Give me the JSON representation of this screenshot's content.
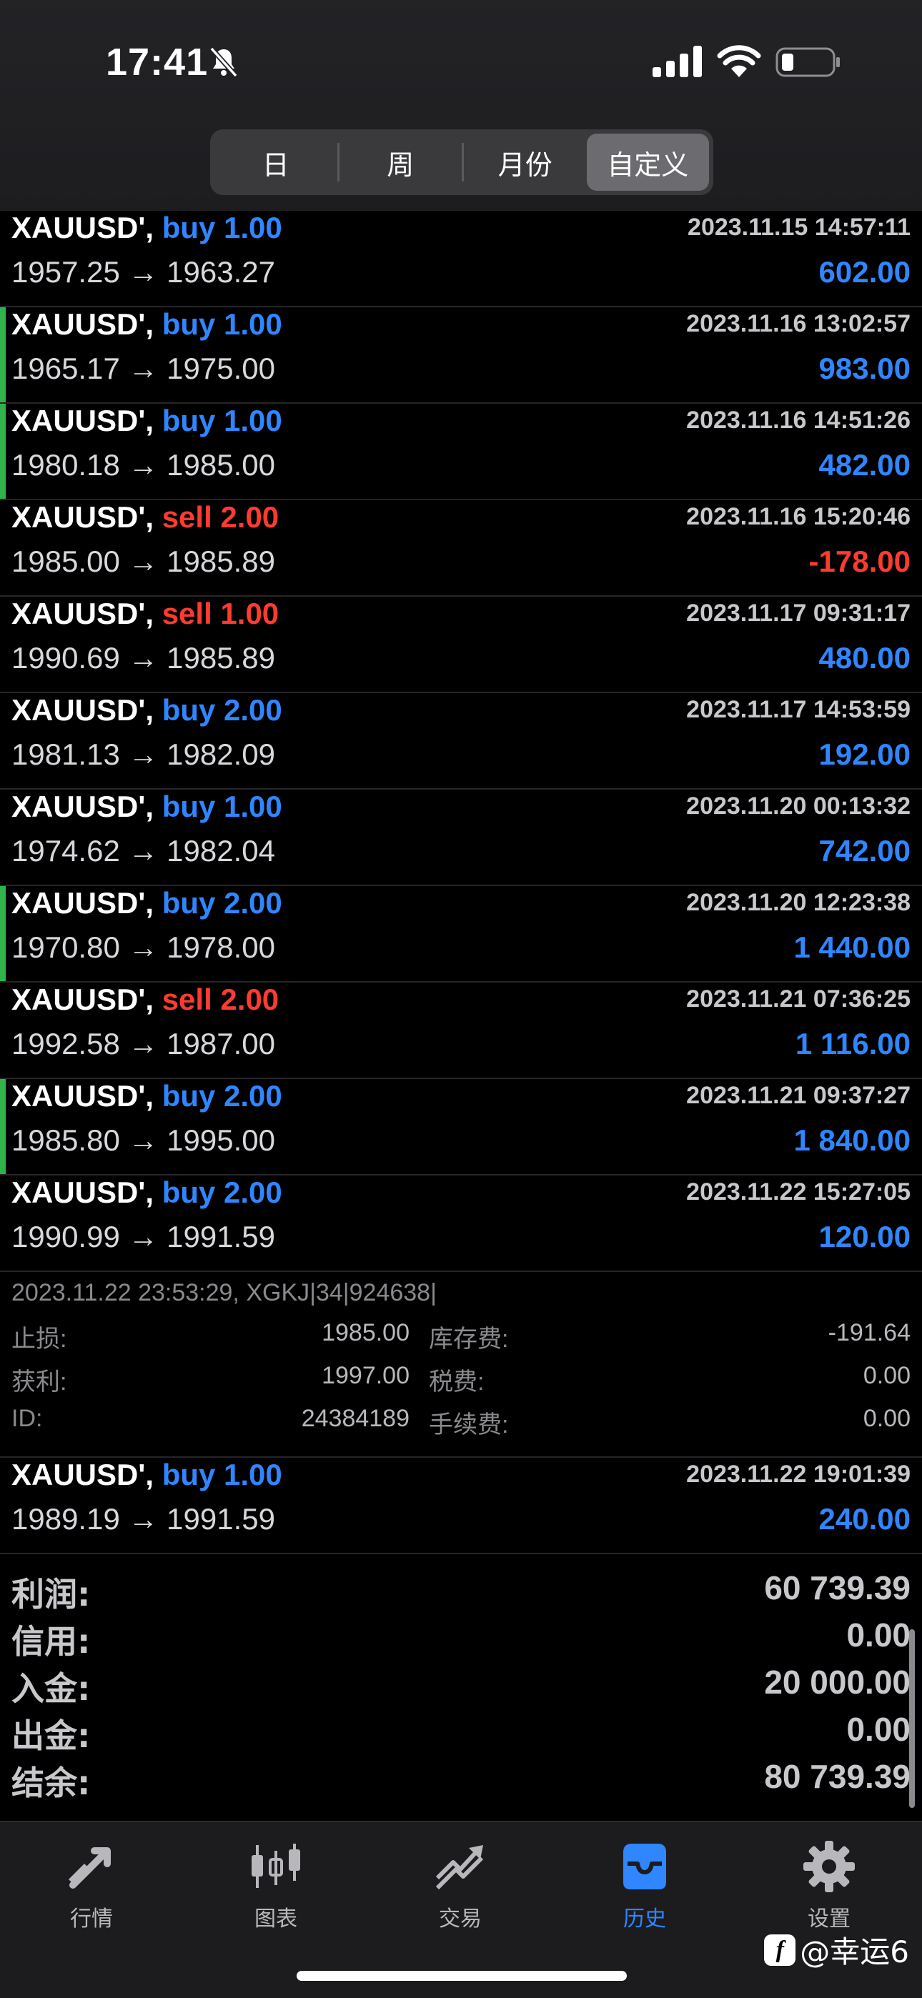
{
  "status_bar": {
    "time": "17:41"
  },
  "segments": [
    {
      "label": "日",
      "active": false
    },
    {
      "label": "周",
      "active": false
    },
    {
      "label": "月份",
      "active": false
    },
    {
      "label": "自定义",
      "active": true
    }
  ],
  "trades": [
    {
      "symbol": "XAUUSD',",
      "side": "buy",
      "volume": "1.00",
      "date": "2023.11.15 14:57:11",
      "prices": "1957.25 → 1963.27",
      "profit": "602.00",
      "marked": false
    },
    {
      "symbol": "XAUUSD',",
      "side": "buy",
      "volume": "1.00",
      "date": "2023.11.16 13:02:57",
      "prices": "1965.17 → 1975.00",
      "profit": "983.00",
      "marked": true
    },
    {
      "symbol": "XAUUSD',",
      "side": "buy",
      "volume": "1.00",
      "date": "2023.11.16 14:51:26",
      "prices": "1980.18 → 1985.00",
      "profit": "482.00",
      "marked": true
    },
    {
      "symbol": "XAUUSD',",
      "side": "sell",
      "volume": "2.00",
      "date": "2023.11.16 15:20:46",
      "prices": "1985.00 → 1985.89",
      "profit": "-178.00",
      "marked": false
    },
    {
      "symbol": "XAUUSD',",
      "side": "sell",
      "volume": "1.00",
      "date": "2023.11.17 09:31:17",
      "prices": "1990.69 → 1985.89",
      "profit": "480.00",
      "marked": false
    },
    {
      "symbol": "XAUUSD',",
      "side": "buy",
      "volume": "2.00",
      "date": "2023.11.17 14:53:59",
      "prices": "1981.13 → 1982.09",
      "profit": "192.00",
      "marked": false
    },
    {
      "symbol": "XAUUSD',",
      "side": "buy",
      "volume": "1.00",
      "date": "2023.11.20 00:13:32",
      "prices": "1974.62 → 1982.04",
      "profit": "742.00",
      "marked": false
    },
    {
      "symbol": "XAUUSD',",
      "side": "buy",
      "volume": "2.00",
      "date": "2023.11.20 12:23:38",
      "prices": "1970.80 → 1978.00",
      "profit": "1 440.00",
      "marked": true
    },
    {
      "symbol": "XAUUSD',",
      "side": "sell",
      "volume": "2.00",
      "date": "2023.11.21 07:36:25",
      "prices": "1992.58 → 1987.00",
      "profit": "1 116.00",
      "marked": false
    },
    {
      "symbol": "XAUUSD',",
      "side": "buy",
      "volume": "2.00",
      "date": "2023.11.21 09:37:27",
      "prices": "1985.80 → 1995.00",
      "profit": "1 840.00",
      "marked": true
    },
    {
      "symbol": "XAUUSD',",
      "side": "buy",
      "volume": "2.00",
      "date": "2023.11.22 15:27:05",
      "prices": "1990.99 → 1991.59",
      "profit": "120.00",
      "marked": false
    }
  ],
  "details": {
    "line": "2023.11.22 23:53:29, XGKJ|34|924638|",
    "rows": [
      {
        "l1": "止损:",
        "v1": "1985.00",
        "l2": "库存费:",
        "v2": "-191.64"
      },
      {
        "l1": "获利:",
        "v1": "1997.00",
        "l2": "税费:",
        "v2": "0.00"
      },
      {
        "l1": "ID:",
        "v1": "24384189",
        "l2": "手续费:",
        "v2": "0.00"
      }
    ]
  },
  "last_trade": {
    "symbol": "XAUUSD',",
    "side": "buy",
    "volume": "1.00",
    "date": "2023.11.22 19:01:39",
    "prices": "1989.19 → 1991.59",
    "profit": "240.00"
  },
  "summary": [
    {
      "label": "利润:",
      "value": "60 739.39"
    },
    {
      "label": "信用:",
      "value": "0.00"
    },
    {
      "label": "入金:",
      "value": "20 000.00"
    },
    {
      "label": "出金:",
      "value": "0.00"
    },
    {
      "label": "结余:",
      "value": "80 739.39"
    }
  ],
  "tabs": [
    {
      "label": "行情",
      "icon": "quotes-arrows-icon",
      "active": false
    },
    {
      "label": "图表",
      "icon": "candlestick-chart-icon",
      "active": false
    },
    {
      "label": "交易",
      "icon": "trade-trend-icon",
      "active": false
    },
    {
      "label": "历史",
      "icon": "history-inbox-icon",
      "active": true
    },
    {
      "label": "设置",
      "icon": "gear-icon",
      "active": false
    }
  ],
  "watermark": {
    "logo": "f",
    "text": "@幸运6"
  },
  "colors": {
    "buy": "#2f86ff",
    "sell": "#ff3b30",
    "marker": "#2fb34b",
    "active_tab": "#2f86ff"
  }
}
